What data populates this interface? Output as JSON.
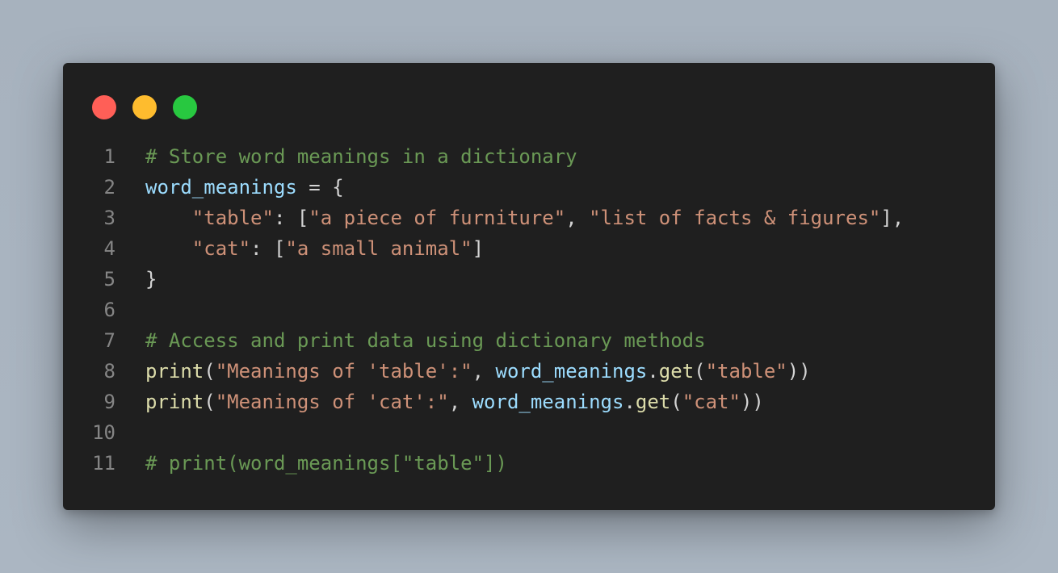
{
  "window": {
    "controls": [
      {
        "name": "close",
        "color": "#ff5f57"
      },
      {
        "name": "minimize",
        "color": "#febc2e"
      },
      {
        "name": "maximize",
        "color": "#28c840"
      }
    ]
  },
  "theme": {
    "background": "#1f1f1f",
    "comment": "#6a9955",
    "variable": "#9cdcfe",
    "string": "#ce9178",
    "function": "#dcdcaa",
    "punctuation": "#d4d4d4",
    "line_number": "#858585"
  },
  "code": {
    "language": "python",
    "lines": [
      {
        "number": "1",
        "tokens": [
          {
            "t": "comment",
            "v": "# Store word meanings in a dictionary"
          }
        ]
      },
      {
        "number": "2",
        "tokens": [
          {
            "t": "var",
            "v": "word_meanings"
          },
          {
            "t": "punct",
            "v": " = {"
          }
        ]
      },
      {
        "number": "3",
        "tokens": [
          {
            "t": "punct",
            "v": "    "
          },
          {
            "t": "string",
            "v": "\"table\""
          },
          {
            "t": "punct",
            "v": ": ["
          },
          {
            "t": "string",
            "v": "\"a piece of furniture\""
          },
          {
            "t": "punct",
            "v": ", "
          },
          {
            "t": "string",
            "v": "\"list of facts & figures\""
          },
          {
            "t": "punct",
            "v": "],"
          }
        ]
      },
      {
        "number": "4",
        "tokens": [
          {
            "t": "punct",
            "v": "    "
          },
          {
            "t": "string",
            "v": "\"cat\""
          },
          {
            "t": "punct",
            "v": ": ["
          },
          {
            "t": "string",
            "v": "\"a small animal\""
          },
          {
            "t": "punct",
            "v": "]"
          }
        ]
      },
      {
        "number": "5",
        "tokens": [
          {
            "t": "punct",
            "v": "}"
          }
        ]
      },
      {
        "number": "6",
        "tokens": []
      },
      {
        "number": "7",
        "tokens": [
          {
            "t": "comment",
            "v": "# Access and print data using dictionary methods"
          }
        ]
      },
      {
        "number": "8",
        "tokens": [
          {
            "t": "func",
            "v": "print"
          },
          {
            "t": "punct",
            "v": "("
          },
          {
            "t": "string",
            "v": "\"Meanings of 'table':\""
          },
          {
            "t": "punct",
            "v": ", "
          },
          {
            "t": "var",
            "v": "word_meanings"
          },
          {
            "t": "punct",
            "v": "."
          },
          {
            "t": "func",
            "v": "get"
          },
          {
            "t": "punct",
            "v": "("
          },
          {
            "t": "string",
            "v": "\"table\""
          },
          {
            "t": "punct",
            "v": "))"
          }
        ]
      },
      {
        "number": "9",
        "tokens": [
          {
            "t": "func",
            "v": "print"
          },
          {
            "t": "punct",
            "v": "("
          },
          {
            "t": "string",
            "v": "\"Meanings of 'cat':\""
          },
          {
            "t": "punct",
            "v": ", "
          },
          {
            "t": "var",
            "v": "word_meanings"
          },
          {
            "t": "punct",
            "v": "."
          },
          {
            "t": "func",
            "v": "get"
          },
          {
            "t": "punct",
            "v": "("
          },
          {
            "t": "string",
            "v": "\"cat\""
          },
          {
            "t": "punct",
            "v": "))"
          }
        ]
      },
      {
        "number": "10",
        "tokens": []
      },
      {
        "number": "11",
        "tokens": [
          {
            "t": "comment",
            "v": "# print(word_meanings[\"table\"])"
          }
        ]
      }
    ]
  }
}
